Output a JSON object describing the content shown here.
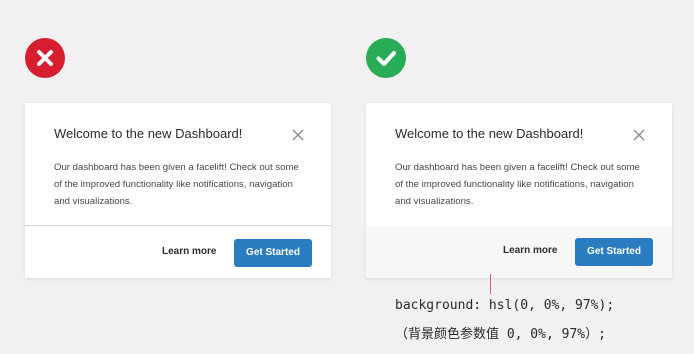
{
  "colors": {
    "page_background": "#f1f1f2",
    "bad_badge": "#d81d2f",
    "good_badge": "#28ac55",
    "primary_button": "#2a7cc0",
    "footer_highlight": "hsl(0, 0%, 97%)",
    "divider": "#d2d2d2",
    "pointer_line": "#e0606f"
  },
  "badges": {
    "bad_icon": "x-mark-icon",
    "good_icon": "check-mark-icon"
  },
  "card_bad": {
    "title": "Welcome to the new Dashboard!",
    "body": "Our dashboard has been given a facelift! Check out some of the improved functionality like notifications, navigation and visualizations.",
    "close_icon": "close-icon",
    "learn_more_label": "Learn more",
    "get_started_label": "Get Started",
    "footer_style": "divider line"
  },
  "card_good": {
    "title": "Welcome to the new Dashboard!",
    "body": "Our dashboard has been given a facelift! Check out some of the improved functionality like notifications, navigation and visualizations.",
    "close_icon": "close-icon",
    "learn_more_label": "Learn more",
    "get_started_label": "Get Started",
    "footer_style": "background tint"
  },
  "annotation": {
    "code": "background: hsl(0, 0%, 97%);",
    "note": "（背景颜色参数值 0, 0%, 97%）;"
  }
}
